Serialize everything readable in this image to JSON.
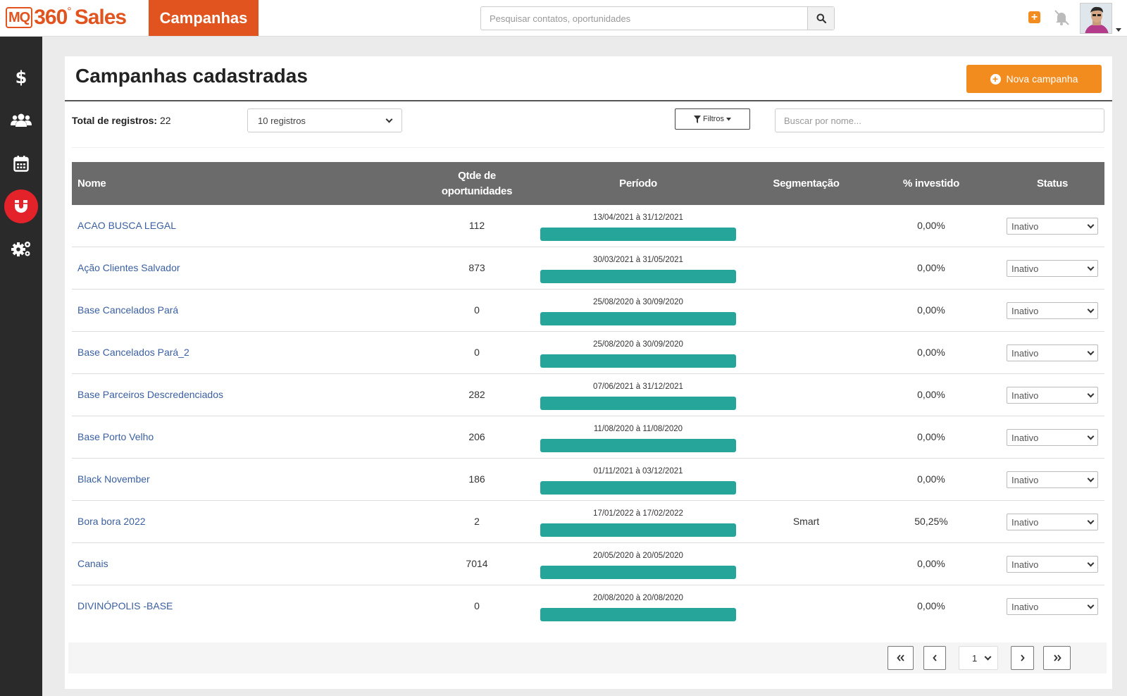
{
  "brand": {
    "mq": "MQ",
    "n360": "360",
    "deg": "°",
    "sales": "Sales",
    "module": "Campanhas"
  },
  "topbar": {
    "search_placeholder": "Pesquisar contatos, oportunidades",
    "add_symbol": "+"
  },
  "sidebar": {
    "items": [
      {
        "icon": "dollar-icon",
        "active": false
      },
      {
        "icon": "users-icon",
        "active": false
      },
      {
        "icon": "calendar-icon",
        "active": false
      },
      {
        "icon": "magnet-icon",
        "active": true
      },
      {
        "icon": "gears-icon",
        "active": false
      }
    ]
  },
  "main": {
    "title": "Campanhas cadastradas",
    "new_button_label": "Nova campanha",
    "total_label": "Total de registros:",
    "total_value": "22",
    "page_size": "10 registros",
    "filters_label": "Filtros",
    "name_search_placeholder": "Buscar por nome..."
  },
  "table": {
    "headers": {
      "name": "Nome",
      "qty": "Qtde de oportunidades",
      "period": "Período",
      "segment": "Segmentação",
      "invested": "% investido",
      "status": "Status"
    },
    "rows": [
      {
        "name": "ACAO BUSCA LEGAL",
        "qty": "112",
        "period": "13/04/2021 à 31/12/2021",
        "progress": 1.0,
        "segment": "",
        "invested": "0,00%",
        "status": "Inativo"
      },
      {
        "name": "Ação Clientes Salvador",
        "qty": "873",
        "period": "30/03/2021 à 31/05/2021",
        "progress": 1.0,
        "segment": "",
        "invested": "0,00%",
        "status": "Inativo"
      },
      {
        "name": "Base Cancelados Pará",
        "qty": "0",
        "period": "25/08/2020 à 30/09/2020",
        "progress": 1.0,
        "segment": "",
        "invested": "0,00%",
        "status": "Inativo"
      },
      {
        "name": "Base Cancelados Pará_2",
        "qty": "0",
        "period": "25/08/2020 à 30/09/2020",
        "progress": 1.0,
        "segment": "",
        "invested": "0,00%",
        "status": "Inativo"
      },
      {
        "name": "Base Parceiros Descredenciados",
        "qty": "282",
        "period": "07/06/2021 à 31/12/2021",
        "progress": 1.0,
        "segment": "",
        "invested": "0,00%",
        "status": "Inativo"
      },
      {
        "name": "Base Porto Velho",
        "qty": "206",
        "period": "11/08/2020 à 11/08/2020",
        "progress": 1.0,
        "segment": "",
        "invested": "0,00%",
        "status": "Inativo"
      },
      {
        "name": "Black November",
        "qty": "186",
        "period": "01/11/2021 à 03/12/2021",
        "progress": 1.0,
        "segment": "",
        "invested": "0,00%",
        "status": "Inativo"
      },
      {
        "name": "Bora bora 2022",
        "qty": "2",
        "period": "17/01/2022 à 17/02/2022",
        "progress": 1.0,
        "segment": "Smart",
        "invested": "50,25%",
        "status": "Inativo"
      },
      {
        "name": "Canais",
        "qty": "7014",
        "period": "20/05/2020 à 20/05/2020",
        "progress": 1.0,
        "segment": "",
        "invested": "0,00%",
        "status": "Inativo"
      },
      {
        "name": "DIVINÓPOLIS -BASE",
        "qty": "0",
        "period": "20/08/2020 à 20/08/2020",
        "progress": 1.0,
        "segment": "",
        "invested": "0,00%",
        "status": "Inativo"
      }
    ]
  },
  "pagination": {
    "current_page": "1"
  },
  "colors": {
    "brand_orange": "#e2541f",
    "button_orange": "#f28c1f",
    "progress_teal": "#26a69a",
    "sidebar_bg": "#2a2a2a",
    "active_red": "#e3222a",
    "header_gray": "#6b6b6b",
    "link_blue": "#3a5fa0"
  }
}
